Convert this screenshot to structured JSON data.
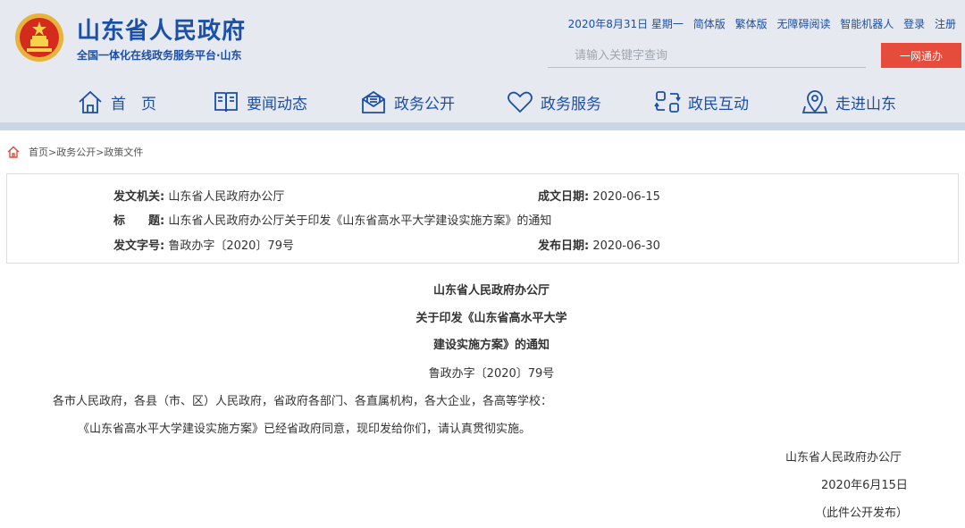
{
  "header": {
    "title": "山东省人民政府",
    "subtitle": "全国一体化在线政务服务平台·山东",
    "top_links": [
      "2020年8月31日 星期一",
      "简体版",
      "繁体版",
      "无障碍阅读",
      "智能机器人",
      "登录",
      "注册"
    ],
    "search_placeholder": "请输入关键字查询",
    "yiwang_label": "一网通办",
    "brand_color": "#1b4fa8",
    "button_color": "#e54c3c"
  },
  "nav": [
    {
      "label": "首　页",
      "icon": "home-icon"
    },
    {
      "label": "要闻动态",
      "icon": "book-icon"
    },
    {
      "label": "政务公开",
      "icon": "mail-open-icon"
    },
    {
      "label": "政务服务",
      "icon": "heart-icon"
    },
    {
      "label": "政民互动",
      "icon": "interaction-icon"
    },
    {
      "label": "走进山东",
      "icon": "map-pin-icon"
    }
  ],
  "breadcrumb": {
    "icon": "home-icon",
    "text": "首页>政务公开>政策文件"
  },
  "meta": {
    "issuer_label": "发文机关:",
    "issuer_value": "山东省人民政府办公厅",
    "date_written_label": "成文日期:",
    "date_written_value": "2020-06-15",
    "title_label": "标　　题:",
    "title_value": "山东省人民政府办公厅关于印发《山东省高水平大学建设实施方案》的通知",
    "doc_no_label": "发文字号:",
    "doc_no_value": "鲁政办字〔2020〕79号",
    "publish_date_label": "发布日期:",
    "publish_date_value": "2020-06-30"
  },
  "document": {
    "heading_1": "山东省人民政府办公厅",
    "heading_2": "关于印发《山东省高水平大学",
    "heading_3": "建设实施方案》的通知",
    "doc_number": "鲁政办字〔2020〕79号",
    "recipients": "各市人民政府，各县（市、区）人民政府，省政府各部门、各直属机构，各大企业，各高等学校：",
    "body": "《山东省高水平大学建设实施方案》已经省政府同意，现印发给你们，请认真贯彻实施。",
    "signature": "山东省人民政府办公厅",
    "sign_date": "2020年6月15日",
    "note": "（此件公开发布）"
  }
}
